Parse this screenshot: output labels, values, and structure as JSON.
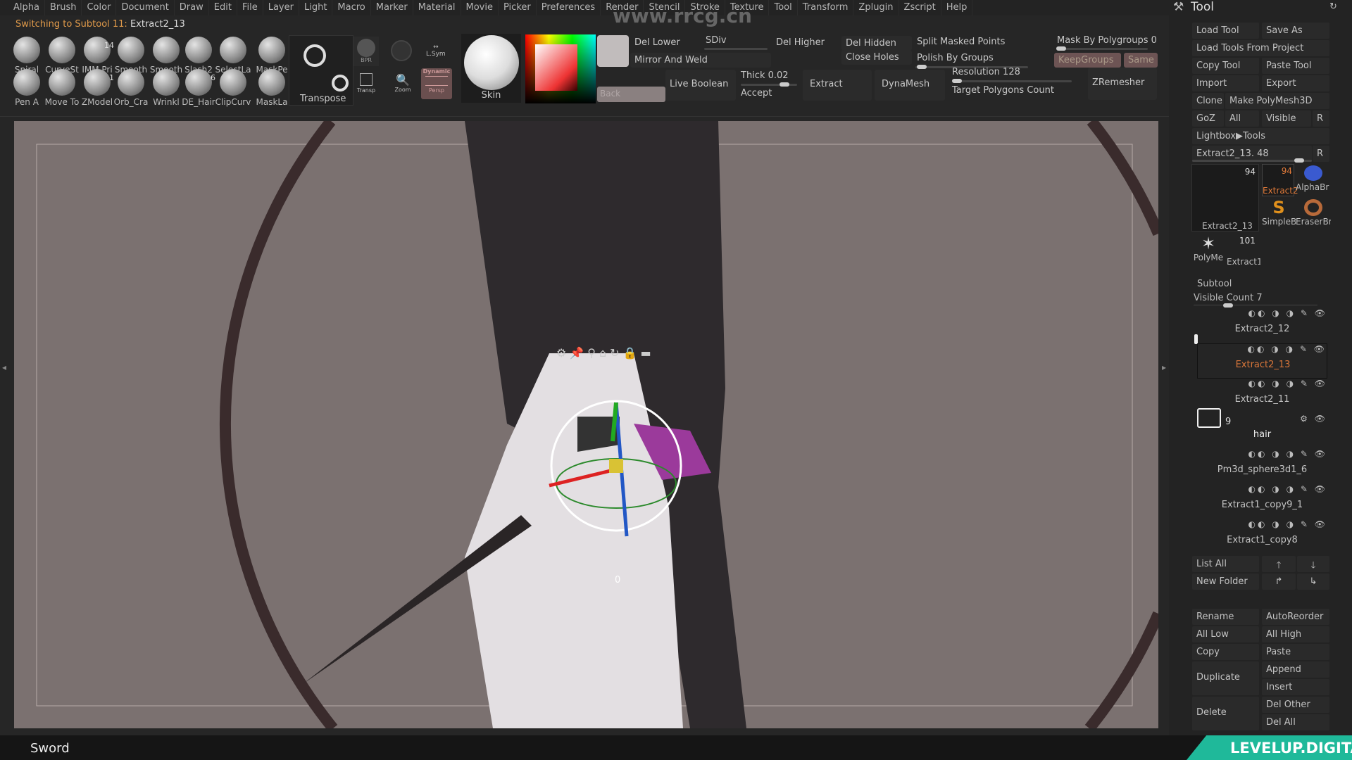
{
  "menu": [
    "Alpha",
    "Brush",
    "Color",
    "Document",
    "Draw",
    "Edit",
    "File",
    "Layer",
    "Light",
    "Macro",
    "Marker",
    "Material",
    "Movie",
    "Picker",
    "Preferences",
    "Render",
    "Stencil",
    "Stroke",
    "Texture",
    "Tool",
    "Transform",
    "Zplugin",
    "Zscript",
    "Help"
  ],
  "status": {
    "prefix": "Switching to Subtool 11:",
    "subtool": "Extract2_13"
  },
  "watermark": "www.rrcg.cn",
  "brushes_row1": [
    {
      "label": "Spiral"
    },
    {
      "label": "CurveSt"
    },
    {
      "label": "IMM Pri",
      "badge": "14"
    },
    {
      "label": "Smooth"
    },
    {
      "label": "Smooth"
    },
    {
      "label": "Slash2"
    },
    {
      "label": "SelectLa"
    },
    {
      "label": "MaskPe"
    }
  ],
  "brushes_row2": [
    {
      "label": "Pen A"
    },
    {
      "label": "Move To"
    },
    {
      "label": "ZModel",
      "badge": "1"
    },
    {
      "label": "Orb_Cra"
    },
    {
      "label": "Wrinkl"
    },
    {
      "label": "DE_Hair",
      "badge": "6"
    },
    {
      "label": "ClipCurv"
    },
    {
      "label": "MaskLa"
    }
  ],
  "toolbar": {
    "transpose": "Transpose",
    "bpr": "BPR",
    "transp": "Transp",
    "lsym": "L.Sym",
    "zoom": "Zoom",
    "dynamic": "Dynamic",
    "persp": "Persp",
    "material": "Skin",
    "back": "Back",
    "del_lower": "Del Lower",
    "sdiv": "SDiv",
    "del_higher": "Del Higher",
    "mirror_weld": "Mirror And Weld",
    "del_hidden": "Del Hidden",
    "close_holes": "Close Holes",
    "split_masked": "Split Masked Points",
    "polish_groups": "Polish By Groups",
    "mask_polygroups": "Mask By Polygroups 0",
    "keep_groups": "KeepGroups",
    "same": "Same",
    "live_boolean": "Live Boolean",
    "thick": "Thick 0.02",
    "accept": "Accept",
    "extract": "Extract",
    "dynamesh": "DynaMesh",
    "resolution": "Resolution 128",
    "target_poly": "Target Polygons Count",
    "zremesher": "ZRemesher"
  },
  "colors": {
    "accent_orange": "#e09a4a",
    "viewport_bg": "#7b7170",
    "levelup": "#1fb99a",
    "keepgroups": "#6d5454"
  },
  "viewport": {
    "gizmo_icons": [
      "gear-icon",
      "pin-icon",
      "location-icon",
      "home-icon",
      "rotate-icon",
      "lock-icon",
      "toggle-icon"
    ],
    "gizmo_value": "0"
  },
  "tool_panel": {
    "title": "Tool",
    "load_tool": "Load Tool",
    "save_as": "Save As",
    "load_project": "Load Tools From Project",
    "copy_tool": "Copy Tool",
    "paste_tool": "Paste Tool",
    "import": "Import",
    "export": "Export",
    "clone": "Clone",
    "make_polymesh": "Make PolyMesh3D",
    "goz": "GoZ",
    "all": "All",
    "visible": "Visible",
    "r": "R",
    "lightbox": "Lightbox▶Tools",
    "current": "Extract2_13. 48",
    "thumbs": [
      {
        "label": "Extract2_13",
        "count": "94"
      },
      {
        "label": "Extract2",
        "count": "94"
      },
      {
        "label": "AlphaBr"
      },
      {
        "label": "SimpleB"
      },
      {
        "label": "EraserBr"
      },
      {
        "label": "PolyMe"
      },
      {
        "label": "Extract1",
        "count": "101"
      }
    ],
    "subtool": "Subtool",
    "visible_count": "Visible Count 7",
    "subtools": [
      {
        "name": "Extract2_12"
      },
      {
        "name": "Extract2_13",
        "selected": true
      },
      {
        "name": "Extract2_11"
      },
      {
        "name": "hair",
        "folder": true,
        "count": "9"
      },
      {
        "name": "Pm3d_sphere3d1_6"
      },
      {
        "name": "Extract1_copy9_1"
      },
      {
        "name": "Extract1_copy8"
      }
    ],
    "list_all": "List All",
    "new_folder": "New Folder",
    "rename": "Rename",
    "autoreorder": "AutoReorder",
    "all_low": "All Low",
    "all_high": "All High",
    "copy": "Copy",
    "paste": "Paste",
    "duplicate": "Duplicate",
    "append": "Append",
    "insert": "Insert",
    "delete": "Delete",
    "del_other": "Del Other",
    "del_all": "Del All"
  },
  "bottom": {
    "tool_name": "Sword",
    "logo": "LEVELUP.DIGITAL"
  }
}
